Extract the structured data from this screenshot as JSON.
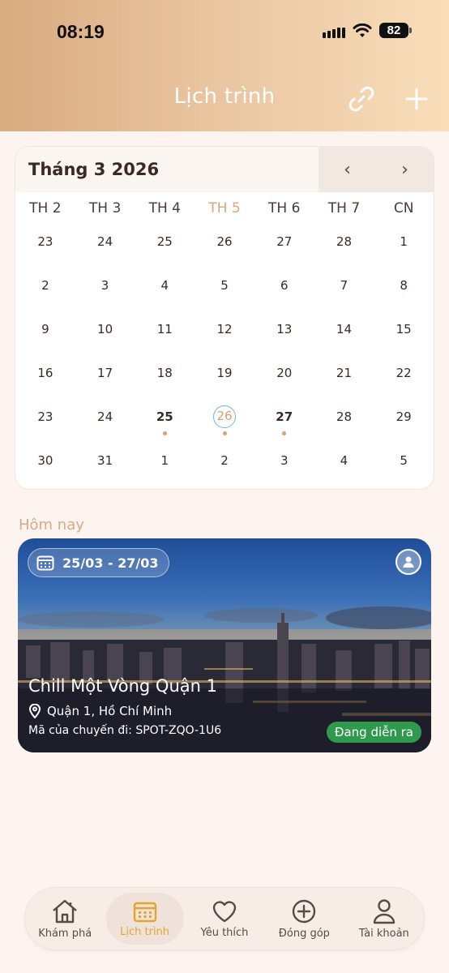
{
  "status_bar": {
    "time": "08:19",
    "battery": "82"
  },
  "header": {
    "title": "Lịch trình"
  },
  "calendar": {
    "month_label": "Tháng 3 2026",
    "prev_label": "‹",
    "next_label": "›",
    "weekdays": [
      "TH 2",
      "TH 3",
      "TH 4",
      "TH 5",
      "TH 6",
      "TH 7",
      "CN"
    ],
    "weeks": [
      [
        "23",
        "24",
        "25",
        "26",
        "27",
        "28",
        "1"
      ],
      [
        "2",
        "3",
        "4",
        "5",
        "6",
        "7",
        "8"
      ],
      [
        "9",
        "10",
        "11",
        "12",
        "13",
        "14",
        "15"
      ],
      [
        "16",
        "17",
        "18",
        "19",
        "20",
        "21",
        "22"
      ],
      [
        "23",
        "24",
        "25",
        "26",
        "27",
        "28",
        "29"
      ],
      [
        "30",
        "31",
        "1",
        "2",
        "3",
        "4",
        "5"
      ]
    ],
    "today_label": "26"
  },
  "section": {
    "title": "Hôm nay"
  },
  "trip": {
    "date_range": "25/03 - 27/03",
    "name": "Chill Một Vòng Quận 1",
    "location": "Quận 1, Hồ Chí Minh",
    "code": "Mã của chuyến đi: SPOT-ZQO-1U6",
    "status": "Đang diễn ra"
  },
  "nav": {
    "items": [
      {
        "label": "Khám phá",
        "icon": "home-icon"
      },
      {
        "label": "Lịch trình",
        "icon": "calendar-icon"
      },
      {
        "label": "Yêu thích",
        "icon": "heart-icon"
      },
      {
        "label": "Đóng góp",
        "icon": "plus-circle-icon"
      },
      {
        "label": "Tài khoản",
        "icon": "user-icon"
      }
    ]
  },
  "colors": {
    "accent": "#e2a52e",
    "today_ring": "#6fb7dc",
    "event_dot": "#d8a074",
    "status_green": "#2f9a4e"
  }
}
